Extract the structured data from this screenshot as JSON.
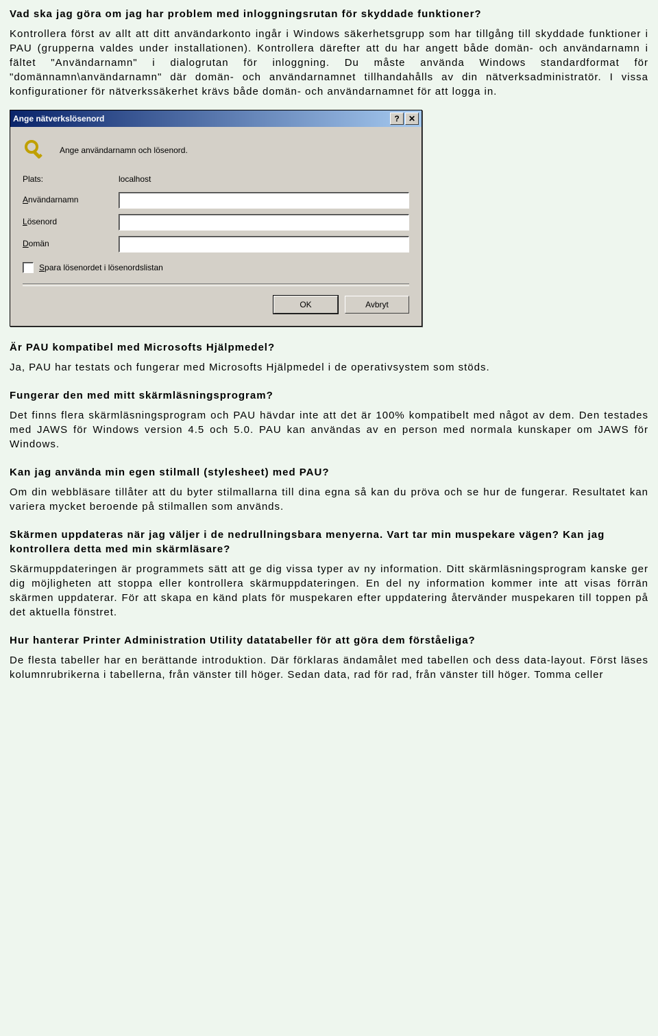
{
  "sections": {
    "s1": {
      "heading": "Vad ska jag göra om jag har problem med inloggningsrutan för skyddade funktioner?",
      "para": "Kontrollera först av allt att ditt användarkonto ingår i Windows säkerhetsgrupp som har tillgång till skyddade funktioner i PAU (grupperna valdes under installationen). Kontrollera därefter att du har angett både domän- och användarnamn i fältet \"Användarnamn\" i dialogrutan för inloggning. Du måste använda Windows standardformat för \"domännamn\\användarnamn\" där domän- och användarnamnet tillhandahålls av din nätverksadministratör. I vissa konfigurationer för nätverkssäkerhet krävs både domän- och användarnamnet för att logga in."
    },
    "s2": {
      "heading": "Är PAU kompatibel med Microsofts Hjälpmedel?",
      "para": "Ja, PAU har testats och fungerar med Microsofts Hjälpmedel i de operativsystem som stöds."
    },
    "s3": {
      "heading": "Fungerar den med mitt skärmläsningsprogram?",
      "para": "Det finns flera skärmläsningsprogram och PAU hävdar inte att det är 100% kompatibelt med något av dem. Den testades med JAWS för Windows version 4.5 och 5.0. PAU kan användas av en person med normala kunskaper om JAWS för Windows."
    },
    "s4": {
      "heading": "Kan jag använda min egen stilmall (stylesheet) med PAU?",
      "para": "Om din webbläsare tillåter att du byter stilmallarna till dina egna så kan du pröva och se hur de fungerar. Resultatet kan variera mycket beroende på stilmallen som används."
    },
    "s5": {
      "heading": "Skärmen uppdateras när jag väljer i de nedrullningsbara menyerna. Vart tar min muspekare vägen? Kan jag kontrollera detta med min skärmläsare?",
      "para": "Skärmuppdateringen är programmets sätt att ge dig vissa typer av ny information. Ditt skärmläsningsprogram kanske ger dig möjligheten att stoppa eller kontrollera skärmuppdateringen. En del ny information kommer inte att visas förrän skärmen uppdaterar. För att skapa en känd plats för muspekaren efter uppdatering återvänder muspekaren till toppen på det aktuella fönstret."
    },
    "s6": {
      "heading": "Hur hanterar Printer Administration Utility datatabeller för att göra dem förståeliga?",
      "para": "De flesta tabeller har en berättande introduktion. Där förklaras ändamålet med tabellen och dess data-layout. Först läses kolumnrubrikerna i tabellerna, från vänster till höger. Sedan data, rad för rad, från vänster till höger. Tomma celler"
    }
  },
  "dialog": {
    "title": "Ange nätverkslösenord",
    "help_glyph": "?",
    "close_glyph": "✕",
    "instruction": "Ange användarnamn och lösenord.",
    "plats_label": "Plats:",
    "plats_value": "localhost",
    "user_prefix": "A",
    "user_rest": "nvändarnamn",
    "pass_prefix": "L",
    "pass_rest": "ösenord",
    "domain_prefix": "D",
    "domain_rest": "omän",
    "save_prefix": "S",
    "save_rest": "para lösenordet i lösenordslistan",
    "ok_label": "OK",
    "cancel_label": "Avbryt"
  }
}
